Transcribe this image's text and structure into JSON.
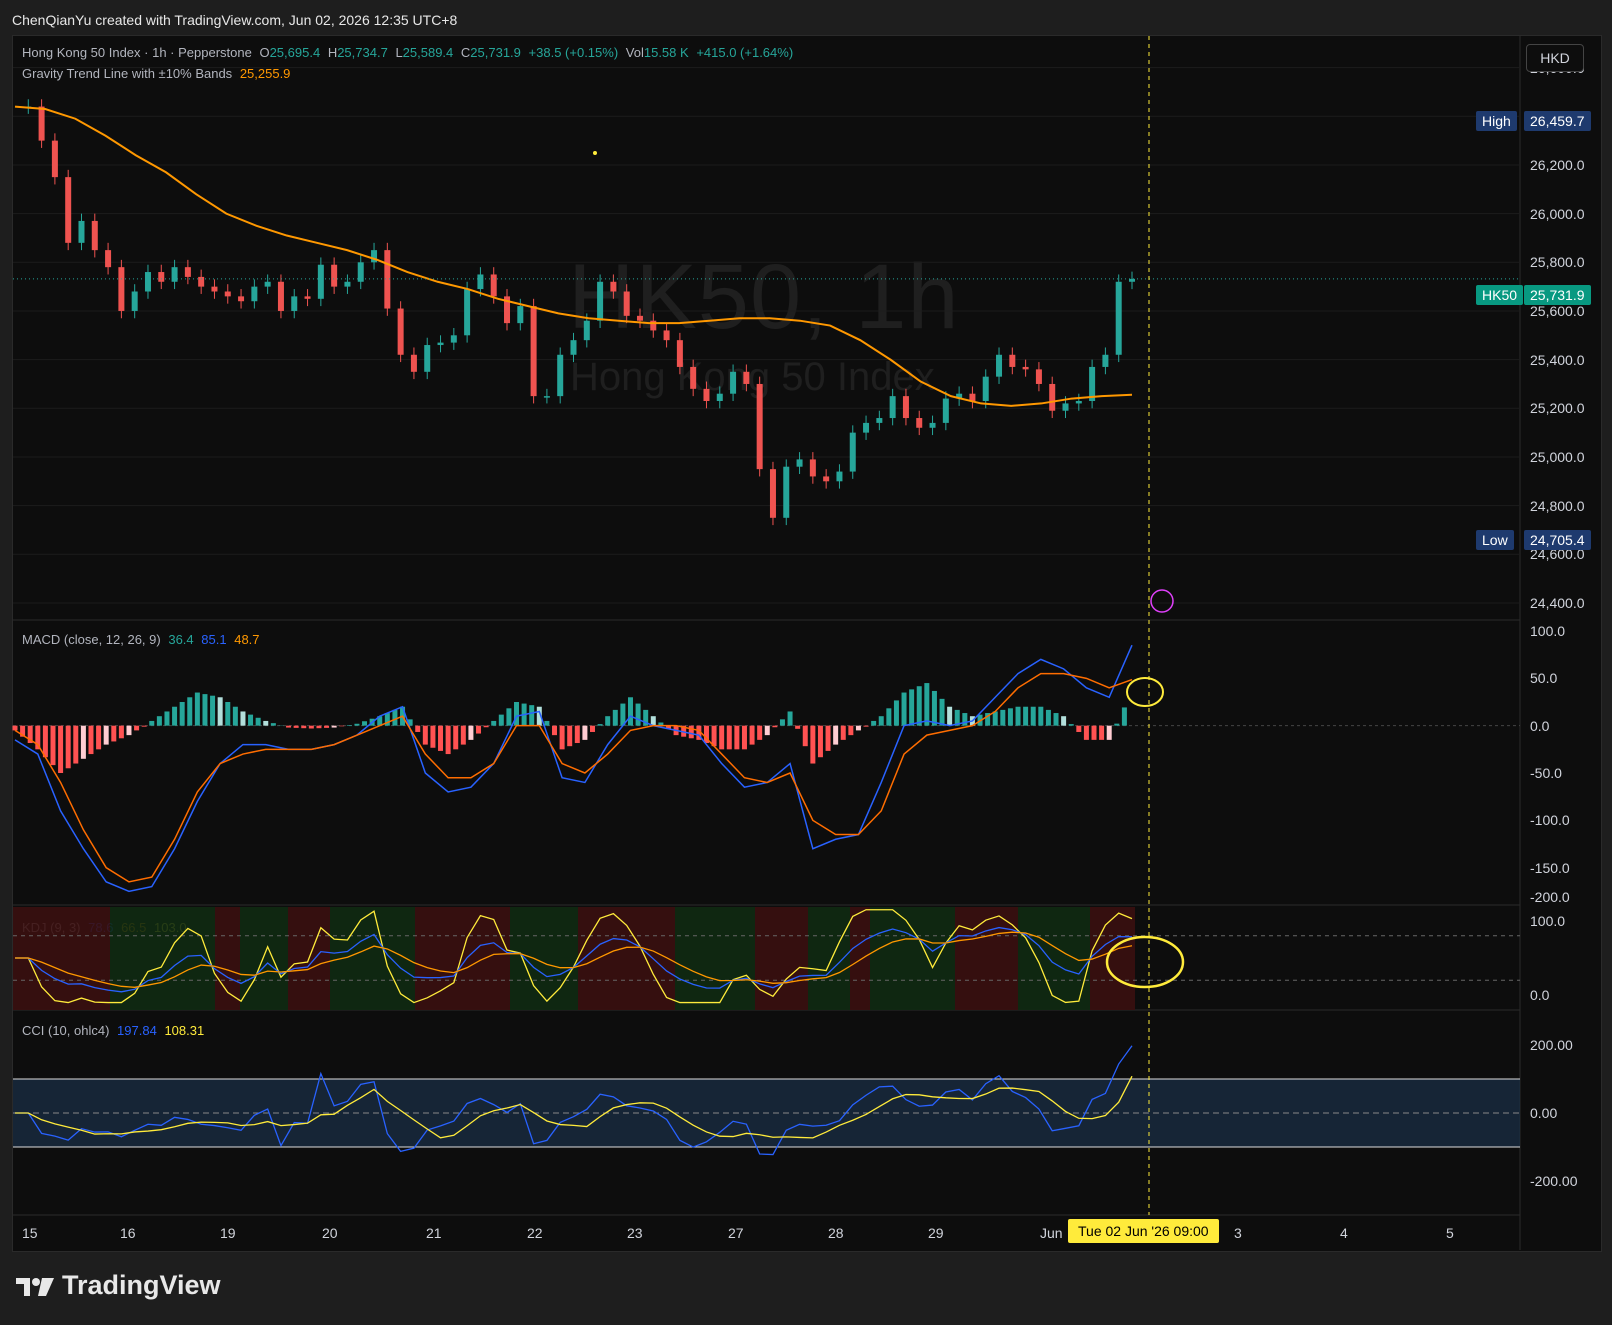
{
  "header": {
    "text": "ChenQianYu created with TradingView.com, Jun 02, 2026 12:35 UTC+8"
  },
  "main": {
    "symbol": "Hong Kong 50 Index · 1h · Pepperstone",
    "o_label": "O",
    "o": "25,695.4",
    "h_label": "H",
    "h": "25,734.7",
    "l_label": "L",
    "l": "25,589.4",
    "c_label": "C",
    "c": "25,731.9",
    "change": "+38.5 (+0.15%)",
    "vol_label": "Vol",
    "vol": "15.58 K",
    "vol_change": "+415.0 (+1.64%)",
    "indicator": "Gravity Trend Line with ±10% Bands",
    "indicator_value": "25,255.9",
    "watermark_1": "HK50, 1h",
    "watermark_2": "Hong Kong 50 Index",
    "currency": "HKD",
    "high_label": "High",
    "high_value": "26,459.7",
    "low_label": "Low",
    "low_value": "24,705.4",
    "last_label": "HK50",
    "last_value": "25,731.9",
    "yticks": [
      "26,600.0",
      "26,400.0",
      "26,200.0",
      "26,000.0",
      "25,800.0",
      "25,600.0",
      "25,400.0",
      "25,200.0",
      "25,000.0",
      "24,800.0",
      "24,600.0",
      "24,400.0"
    ]
  },
  "macd": {
    "label": "MACD (close, 12, 26, 9)",
    "v1": "36.4",
    "v2": "85.1",
    "v3": "48.7",
    "yticks": [
      "100.0",
      "50.0",
      "0.0",
      "-50.0",
      "-100.0",
      "-150.0",
      "-200.0"
    ]
  },
  "kdj": {
    "label": "KDJ (9, 3)",
    "k": "78.6",
    "d": "66.5",
    "j": "103.0",
    "yticks": [
      "100.0",
      "0.0"
    ]
  },
  "cci": {
    "label": "CCI (10, ohlc4)",
    "v1": "197.84",
    "v2": "108.31",
    "yticks": [
      "200.00",
      "0.00",
      "-200.00"
    ]
  },
  "xaxis": {
    "ticks": [
      "15",
      "16",
      "19",
      "20",
      "21",
      "22",
      "23",
      "27",
      "28",
      "29",
      "Jun",
      "3",
      "4",
      "5"
    ],
    "crosshair": "Tue 02 Jun '26   09:00"
  },
  "brand": "TradingView",
  "colors": {
    "up": "#26a69a",
    "down": "#ef5350",
    "trend": "#ff9800",
    "macd": "#2962ff",
    "signal": "#ff6d00",
    "highlight": "#ffeb3b"
  },
  "chart_data": [
    {
      "type": "candlestick",
      "title": "Hong Kong 50 Index · 1h · Pepperstone",
      "ylim": [
        24330,
        26730
      ],
      "x_range_days": [
        "15",
        "5"
      ],
      "price_path": [
        26440,
        26440,
        26300,
        26150,
        25880,
        25970,
        25850,
        25780,
        25600,
        25680,
        25760,
        25720,
        25780,
        25740,
        25700,
        25680,
        25660,
        25640,
        25700,
        25720,
        25600,
        25660,
        25650,
        25790,
        25700,
        25720,
        25800,
        25850,
        25610,
        25420,
        25350,
        25460,
        25470,
        25500,
        25690,
        25750,
        25660,
        25550,
        25620,
        25250,
        25250,
        25420,
        25480,
        25560,
        25720,
        25680,
        25580,
        25560,
        25520,
        25480,
        25370,
        25280,
        25230,
        25260,
        25350,
        25300,
        24950,
        24750,
        24960,
        24990,
        24920,
        24900,
        24940,
        25100,
        25140,
        25160,
        25250,
        25160,
        25120,
        25140,
        25240,
        25260,
        25230,
        25330,
        25420,
        25370,
        25360,
        25300,
        25190,
        25220,
        25230,
        25370,
        25420,
        25720,
        25731.9
      ],
      "trend_line": [
        26440,
        26430,
        26390,
        26320,
        26240,
        26170,
        26080,
        26000,
        25950,
        25910,
        25880,
        25850,
        25810,
        25760,
        25720,
        25690,
        25650,
        25620,
        25590,
        25570,
        25560,
        25550,
        25550,
        25560,
        25570,
        25570,
        25560,
        25540,
        25480,
        25400,
        25310,
        25250,
        25220,
        25210,
        25220,
        25240,
        25250,
        25255.9
      ],
      "high": 26459.7,
      "low": 24705.4,
      "last": 25731.9
    },
    {
      "type": "bar+line",
      "title": "MACD (close, 12, 26, 9)",
      "ylim": [
        -200,
        100
      ],
      "macd_path": [
        -15,
        -30,
        -90,
        -130,
        -165,
        -175,
        -170,
        -130,
        -80,
        -40,
        -20,
        -20,
        -25,
        -25,
        -20,
        -10,
        10,
        20,
        -50,
        -70,
        -65,
        -40,
        10,
        15,
        -55,
        -60,
        -20,
        10,
        0,
        -5,
        -10,
        -40,
        -65,
        -60,
        -40,
        -130,
        -120,
        -115,
        -60,
        0,
        5,
        0,
        5,
        30,
        55,
        70,
        60,
        40,
        30,
        85
      ],
      "signal_path": [
        -5,
        -20,
        -60,
        -110,
        -150,
        -165,
        -160,
        -120,
        -70,
        -40,
        -30,
        -25,
        -25,
        -25,
        -20,
        -10,
        0,
        10,
        -30,
        -55,
        -55,
        -40,
        0,
        0,
        -40,
        -50,
        -30,
        -5,
        0,
        0,
        -5,
        -30,
        -55,
        -60,
        -50,
        -100,
        -115,
        -115,
        -90,
        -30,
        -10,
        -5,
        0,
        15,
        40,
        55,
        55,
        50,
        40,
        48.7
      ],
      "hist_path": [
        -5,
        -25,
        -50,
        -35,
        -20,
        -10,
        5,
        20,
        35,
        30,
        15,
        5,
        -2,
        -3,
        -2,
        2,
        10,
        20,
        -20,
        -30,
        -15,
        5,
        25,
        20,
        -25,
        -15,
        10,
        30,
        10,
        -10,
        -15,
        -25,
        -25,
        -10,
        15,
        -40,
        -20,
        -5,
        10,
        35,
        45,
        20,
        10,
        15,
        20,
        20,
        10,
        -15,
        -15,
        36.4
      ],
      "last_macd": 85.1,
      "last_signal": 48.7,
      "last_hist": 36.4
    },
    {
      "type": "line",
      "title": "KDJ (9, 3)",
      "ylim": [
        -20,
        120
      ],
      "k_last": 78.6,
      "d_last": 66.5,
      "j_last": 103.0
    },
    {
      "type": "line",
      "title": "CCI (10, ohlc4)",
      "ylim": [
        -300,
        300
      ],
      "bands": [
        -100,
        100
      ],
      "cci_last": 197.84,
      "ma_last": 108.31
    }
  ]
}
